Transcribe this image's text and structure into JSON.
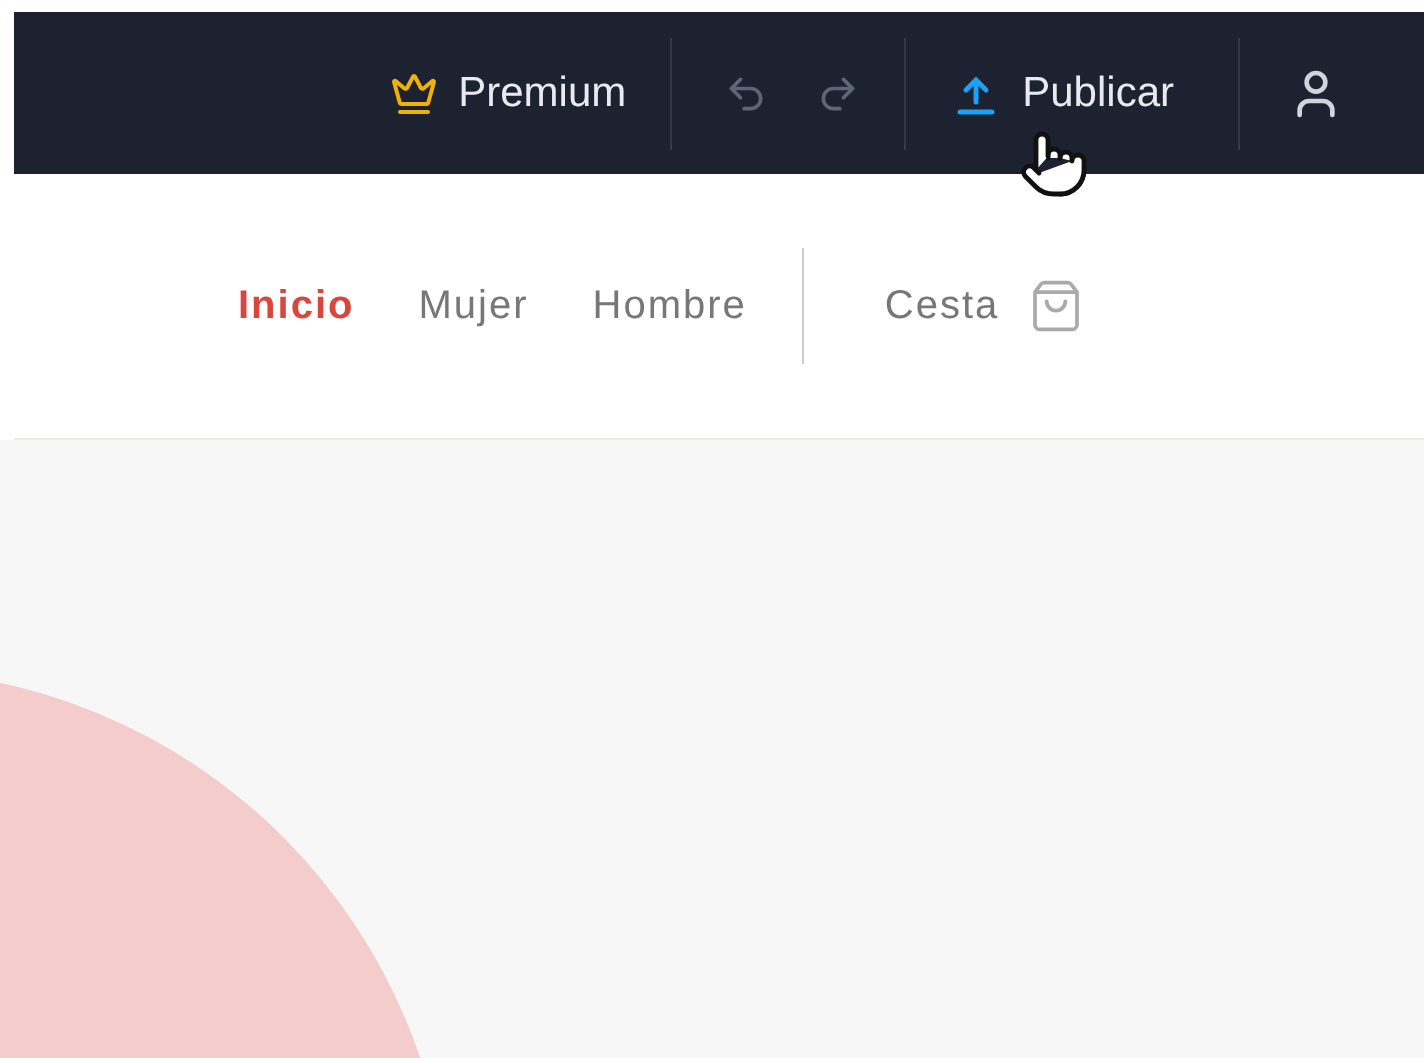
{
  "toolbar": {
    "premium": "Premium",
    "publish": "Publicar"
  },
  "nav": {
    "items": [
      {
        "label": "Inicio",
        "selected": true
      },
      {
        "label": "Mujer",
        "selected": false
      },
      {
        "label": "Hombre",
        "selected": false
      }
    ],
    "cart": "Cesta"
  }
}
